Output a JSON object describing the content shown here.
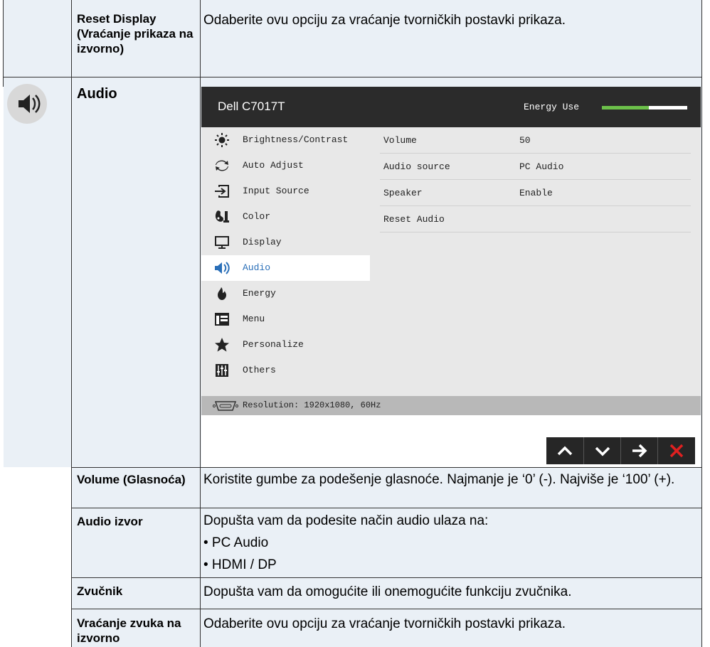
{
  "rows": {
    "reset_display": {
      "label": "Reset Display (Vraćanje prikaza na izvorno)",
      "desc": "Odaberite ovu opciju za vraćanje tvorničkih postavki prikaza."
    },
    "audio": {
      "label": "Audio",
      "icon": "speaker-icon"
    },
    "volume": {
      "label": "Volume (Glasnoća)",
      "desc": "Koristite gumbe za podešenje glasnoće. Najmanje je ‘0’ (-). Najviše je ‘100’ (+)."
    },
    "audio_source": {
      "label": "Audio izvor",
      "desc": "Dopušta vam da podesite način audio ulaza na:",
      "options": [
        "• PC Audio",
        "• HDMI / DP"
      ]
    },
    "speaker": {
      "label": "Zvučnik",
      "desc": "Dopušta vam da omogućite ili onemogućite funkciju zvučnika."
    },
    "reset_audio": {
      "label": "Vraćanje zvuka na izvorno",
      "desc": "Odaberite ovu opciju za vraćanje tvorničkih postavki prikaza."
    }
  },
  "osd": {
    "model": "Dell C7017T",
    "energy_label": "Energy Use",
    "energy_level": 0.55,
    "menu": [
      {
        "label": "Brightness/Contrast",
        "icon": "sun-icon"
      },
      {
        "label": "Auto Adjust",
        "icon": "auto-adjust-icon"
      },
      {
        "label": "Input Source",
        "icon": "input-source-icon"
      },
      {
        "label": "Color",
        "icon": "color-icon"
      },
      {
        "label": "Display",
        "icon": "display-icon"
      },
      {
        "label": "Audio",
        "icon": "speaker-icon",
        "active": true
      },
      {
        "label": "Energy",
        "icon": "energy-icon"
      },
      {
        "label": "Menu",
        "icon": "menu-icon"
      },
      {
        "label": "Personalize",
        "icon": "star-icon"
      },
      {
        "label": "Others",
        "icon": "others-icon"
      }
    ],
    "settings": [
      {
        "name": "Volume",
        "value": "50"
      },
      {
        "name": "Audio source",
        "value": "PC Audio"
      },
      {
        "name": "Speaker",
        "value": "Enable"
      },
      {
        "name": "Reset Audio",
        "value": ""
      }
    ],
    "resolution": "Resolution: 1920x1080, 60Hz",
    "buttons": [
      "up-button",
      "down-button",
      "enter-button",
      "exit-button"
    ],
    "colors": {
      "header": "#2b2b2b",
      "energy": "#6cc04a",
      "active_text": "#2a6fb8",
      "exit": "#e02020"
    }
  }
}
